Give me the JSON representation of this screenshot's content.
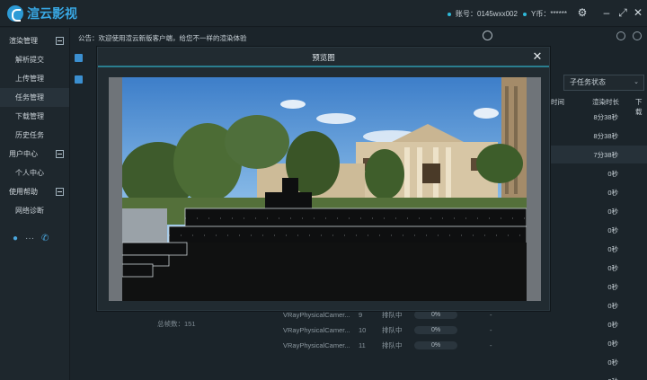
{
  "app": {
    "title": "渲云影视"
  },
  "account": {
    "label": "账号：0145wxx002",
    "password": "Y币：******"
  },
  "sidebar": {
    "groups": [
      {
        "label": "渲染管理",
        "items": [
          "解析提交",
          "上传管理",
          "任务管理",
          "下载管理",
          "历史任务"
        ]
      },
      {
        "label": "用户中心",
        "items": [
          "个人中心"
        ]
      },
      {
        "label": "使用帮助",
        "items": [
          "网络诊断"
        ]
      }
    ],
    "active_item": "任务管理"
  },
  "notice": {
    "text": "公告：欢迎使用渲云新版客户端，给您不一样的渲染体验"
  },
  "filter": {
    "subtask_status": "子任务状态"
  },
  "table": {
    "headers": [
      "时间",
      "渲染时长",
      "下载"
    ],
    "render_times": [
      "8分38秒",
      "8分38秒",
      "7分38秒",
      "0秒",
      "0秒",
      "0秒",
      "0秒",
      "0秒",
      "0秒",
      "0秒",
      "0秒",
      "0秒",
      "0秒",
      "0秒",
      "0秒"
    ]
  },
  "left_panel": {
    "frames_label": "总帧数：151"
  },
  "queue_rows": [
    {
      "camera": "VRayPhysicalCamer...",
      "index": "9",
      "status": "排队中",
      "progress": "0%",
      "dash": "-"
    },
    {
      "camera": "VRayPhysicalCamer...",
      "index": "10",
      "status": "排队中",
      "progress": "0%",
      "dash": "-"
    },
    {
      "camera": "VRayPhysicalCamer...",
      "index": "11",
      "status": "排队中",
      "progress": "0%",
      "dash": "-"
    }
  ],
  "modal": {
    "title": "预览图"
  },
  "icons": {
    "settings": "gear-icon",
    "minimize": "minimize-icon",
    "maximize": "maximize-icon",
    "close": "close-icon",
    "search": "search-icon",
    "refresh": "refresh-icon",
    "qq": "qq-icon",
    "more": "more-icon",
    "phone": "phone-icon"
  },
  "colors": {
    "accent": "#38a7e3",
    "modal_line": "#2a7e8f",
    "background": "#1b2329"
  }
}
